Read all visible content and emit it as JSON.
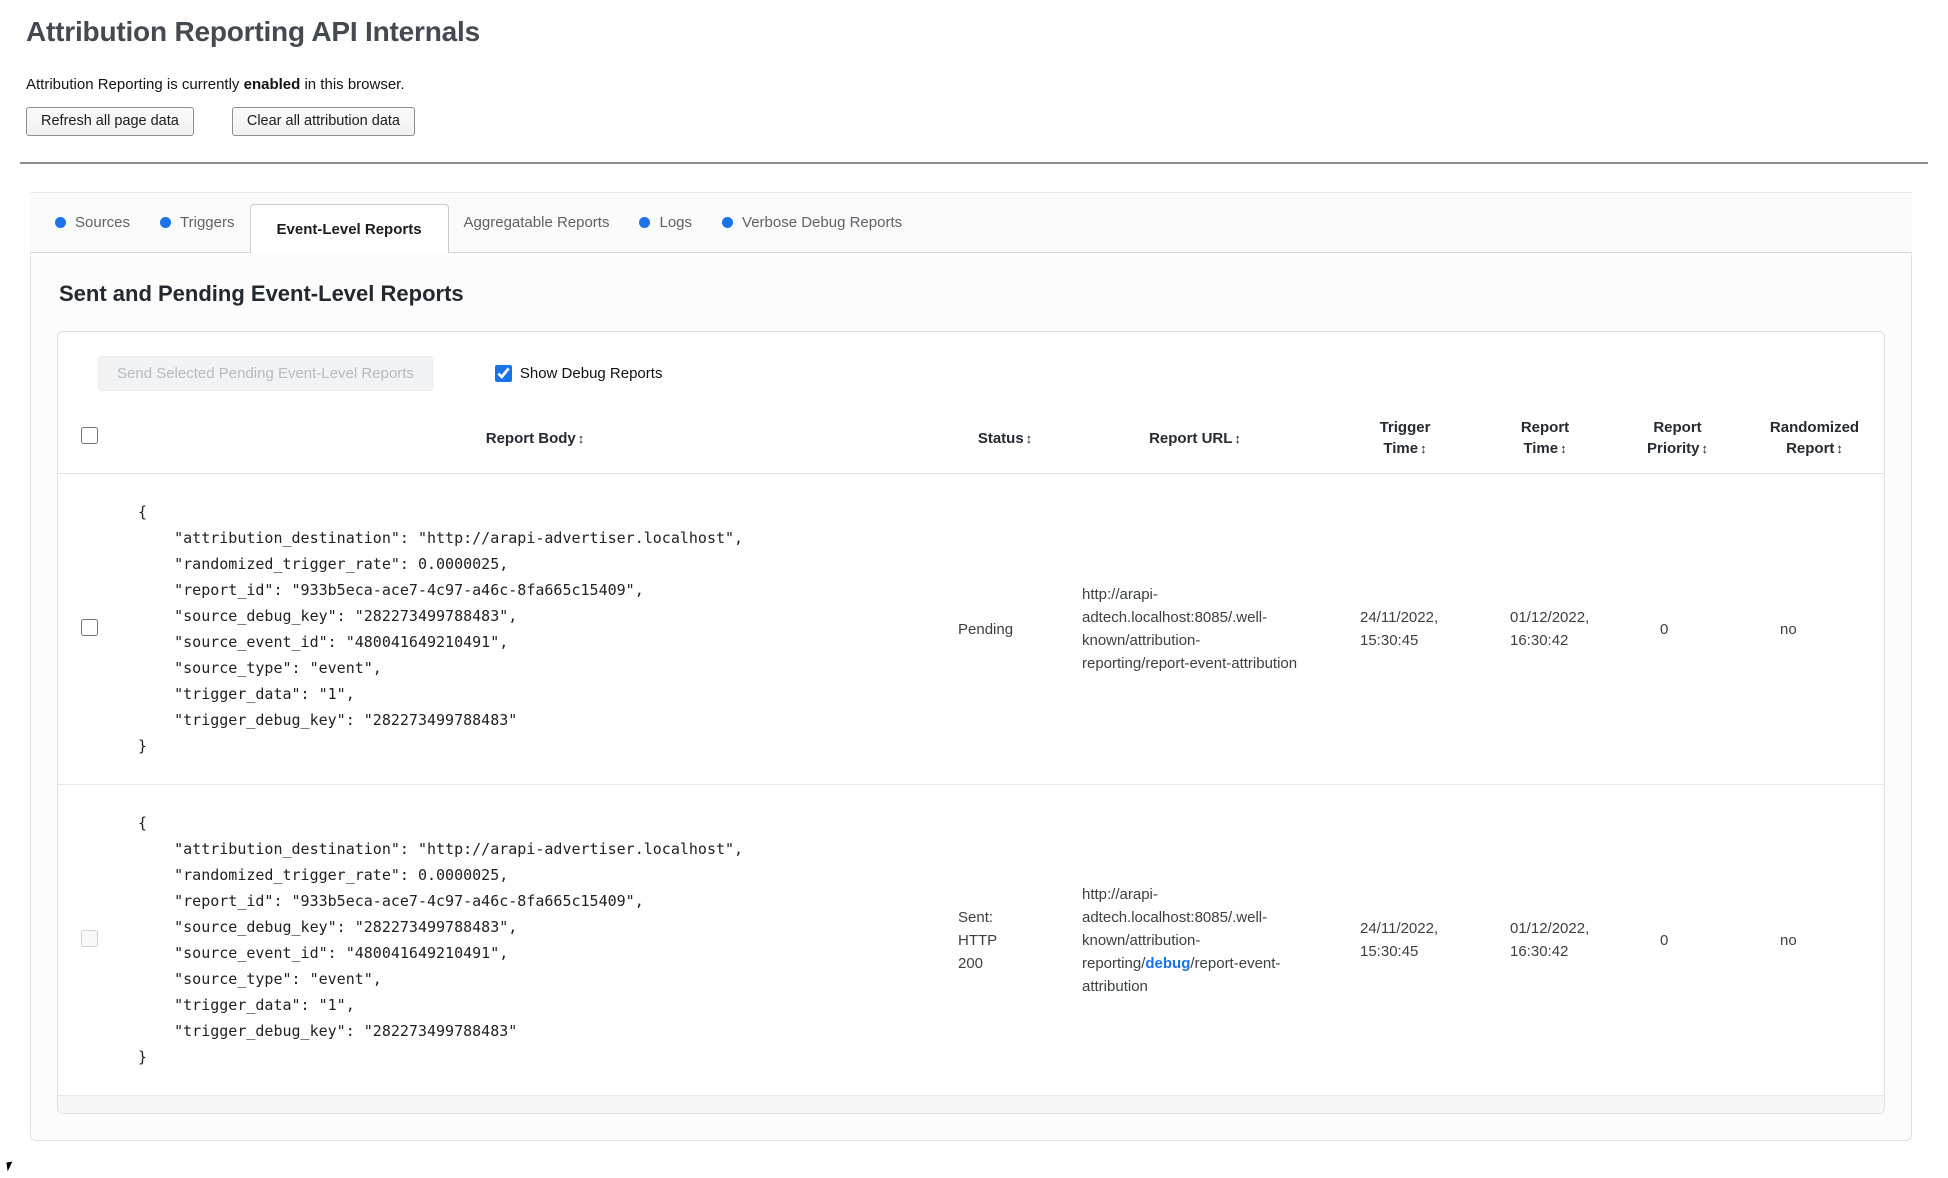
{
  "colors": {
    "accent_blue": "#1a73e8"
  },
  "page": {
    "title": "Attribution Reporting API Internals",
    "status_prefix": "Attribution Reporting is currently ",
    "status_bold": "enabled",
    "status_suffix": " in this browser.",
    "refresh_button": "Refresh all page data",
    "clear_button": "Clear all attribution data"
  },
  "tabs": {
    "sources": "Sources",
    "triggers": "Triggers",
    "event_level": "Event-Level Reports",
    "aggregatable": "Aggregatable Reports",
    "logs": "Logs",
    "verbose_debug": "Verbose Debug Reports"
  },
  "section": {
    "heading": "Sent and Pending Event-Level Reports",
    "send_button": "Send Selected Pending Event-Level Reports",
    "show_debug_label": "Show Debug Reports"
  },
  "table": {
    "sort_icon": "↕",
    "headers": [
      {
        "line1": "",
        "line2": "Report Body"
      },
      {
        "line1": "",
        "line2": "Status"
      },
      {
        "line1": "",
        "line2": "Report URL"
      },
      {
        "line1": "Trigger",
        "line2": "Time"
      },
      {
        "line1": "Report",
        "line2": "Time"
      },
      {
        "line1": "Report",
        "line2": "Priority"
      },
      {
        "line1": "Randomized",
        "line2": "Report"
      }
    ],
    "rows": [
      {
        "report_body": "{\n    \"attribution_destination\": \"http://arapi-advertiser.localhost\",\n    \"randomized_trigger_rate\": 0.0000025,\n    \"report_id\": \"933b5eca-ace7-4c97-a46c-8fa665c15409\",\n    \"source_debug_key\": \"282273499788483\",\n    \"source_event_id\": \"480041649210491\",\n    \"source_type\": \"event\",\n    \"trigger_data\": \"1\",\n    \"trigger_debug_key\": \"282273499788483\"\n}",
        "status": "Pending",
        "url_pre": "http://arapi-adtech.localhost:8085/.well-known/attribution-reporting/",
        "url_debug": "",
        "url_post": "report-event-attribution",
        "trigger_time": "24/11/2022, 15:30:45",
        "report_time": "01/12/2022, 16:30:42",
        "report_priority": "0",
        "randomized_report": "no"
      },
      {
        "report_body": "{\n    \"attribution_destination\": \"http://arapi-advertiser.localhost\",\n    \"randomized_trigger_rate\": 0.0000025,\n    \"report_id\": \"933b5eca-ace7-4c97-a46c-8fa665c15409\",\n    \"source_debug_key\": \"282273499788483\",\n    \"source_event_id\": \"480041649210491\",\n    \"source_type\": \"event\",\n    \"trigger_data\": \"1\",\n    \"trigger_debug_key\": \"282273499788483\"\n}",
        "status": "Sent: HTTP 200",
        "url_pre": "http://arapi-adtech.localhost:8085/.well-known/attribution-reporting/",
        "url_debug": "debug",
        "url_post": "/report-event-attribution",
        "trigger_time": "24/11/2022, 15:30:45",
        "report_time": "01/12/2022, 16:30:42",
        "report_priority": "0",
        "randomized_report": "no"
      }
    ]
  }
}
